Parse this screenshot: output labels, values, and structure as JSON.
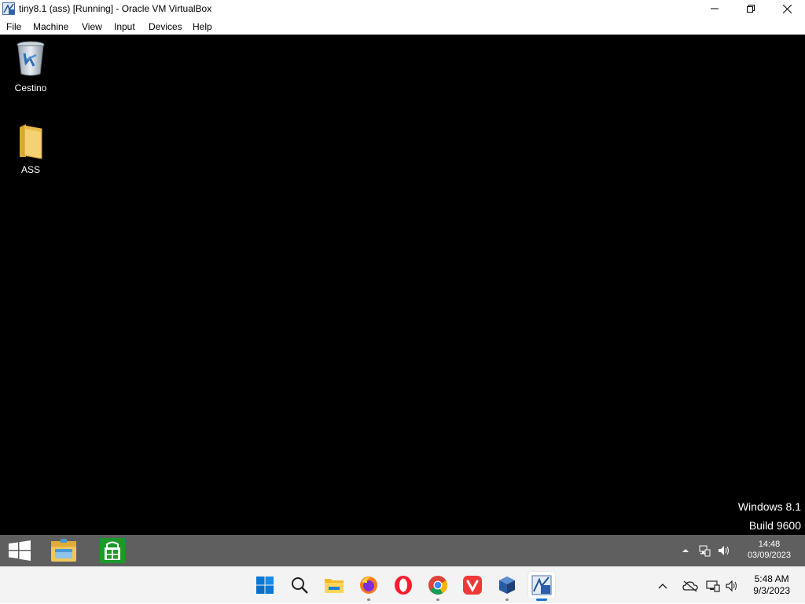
{
  "window": {
    "title": "tiny8.1 (ass) [Running] - Oracle VM VirtualBox",
    "icon": "virtualbox-vm-icon",
    "controls": [
      "minimize-icon",
      "restore-icon",
      "close-icon"
    ]
  },
  "menu": {
    "items": [
      "File",
      "Machine",
      "View",
      "Input",
      "Devices",
      "Help"
    ]
  },
  "vm_desktop": {
    "background": "#000000",
    "icons": [
      {
        "label": "Cestino",
        "icon": "recycle-bin-icon"
      },
      {
        "label": "ASS",
        "icon": "folder-icon"
      }
    ],
    "watermark": {
      "line1": "Windows 8.1",
      "line2": "Build 9600"
    }
  },
  "vm_taskbar": {
    "color": "#5f5f5f",
    "buttons": [
      "start-icon",
      "file-explorer-icon",
      "store-icon"
    ],
    "tray": [
      "chevron-up-icon",
      "network-icon",
      "volume-icon"
    ],
    "clock": {
      "time": "14:48",
      "date": "03/09/2023"
    }
  },
  "host_taskbar": {
    "color": "#f3f3f3",
    "apps": [
      "windows-start-icon",
      "search-icon",
      "file-explorer-icon",
      "firefox-icon",
      "opera-icon",
      "chrome-icon",
      "vivaldi-icon",
      "virtualbox-icon",
      "virtualbox-vm-icon"
    ],
    "tray": [
      "chevron-up-icon",
      "onedrive-icon",
      "network-icon",
      "volume-icon"
    ],
    "clock": {
      "time": "5:48 AM",
      "date": "9/3/2023"
    }
  }
}
